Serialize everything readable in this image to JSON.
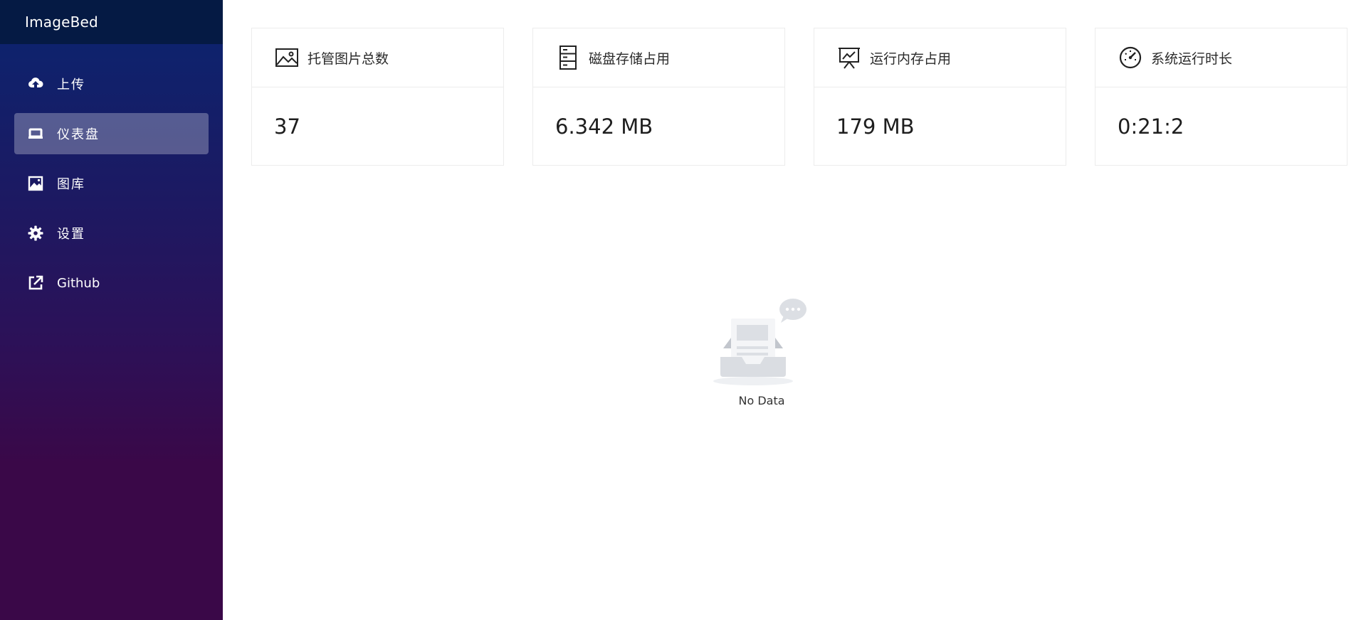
{
  "app": {
    "title": "ImageBed"
  },
  "sidebar": {
    "items": [
      {
        "label": "上传",
        "icon": "upload-cloud-icon",
        "active": false
      },
      {
        "label": "仪表盘",
        "icon": "dashboard-icon",
        "active": true
      },
      {
        "label": "图库",
        "icon": "gallery-icon",
        "active": false
      },
      {
        "label": "设置",
        "icon": "gear-icon",
        "active": false
      },
      {
        "label": "Github",
        "icon": "external-link-icon",
        "active": false
      }
    ]
  },
  "stats": [
    {
      "title": "托管图片总数",
      "value": "37",
      "icon": "picture-icon"
    },
    {
      "title": "磁盘存储占用",
      "value": "6.342 MB",
      "icon": "server-icon"
    },
    {
      "title": "运行内存占用",
      "value": "179 MB",
      "icon": "presentation-chart-icon"
    },
    {
      "title": "系统运行时长",
      "value": "0:21:2",
      "icon": "speedometer-icon"
    }
  ],
  "empty_state": {
    "text": "No Data"
  },
  "colors": {
    "sidebar_top": "#0a2570",
    "sidebar_bottom": "#3a0848",
    "brand_bg": "#051a44"
  }
}
